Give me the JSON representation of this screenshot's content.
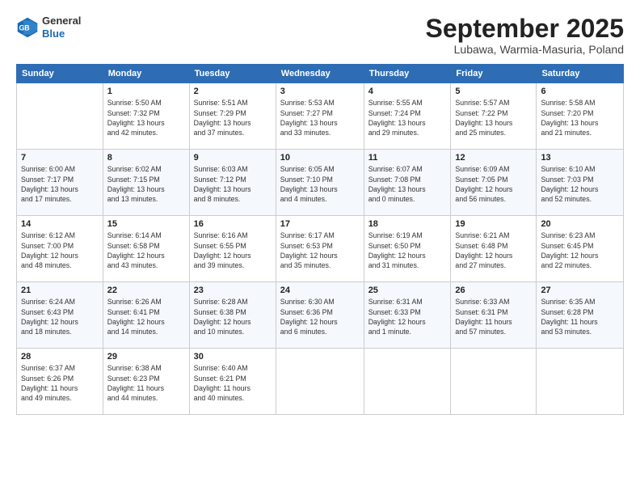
{
  "header": {
    "logo": {
      "line1": "General",
      "line2": "Blue"
    },
    "title": "September 2025",
    "location": "Lubawa, Warmia-Masuria, Poland"
  },
  "days_of_week": [
    "Sunday",
    "Monday",
    "Tuesday",
    "Wednesday",
    "Thursday",
    "Friday",
    "Saturday"
  ],
  "weeks": [
    [
      {
        "day": "",
        "info": ""
      },
      {
        "day": "1",
        "info": "Sunrise: 5:50 AM\nSunset: 7:32 PM\nDaylight: 13 hours\nand 42 minutes."
      },
      {
        "day": "2",
        "info": "Sunrise: 5:51 AM\nSunset: 7:29 PM\nDaylight: 13 hours\nand 37 minutes."
      },
      {
        "day": "3",
        "info": "Sunrise: 5:53 AM\nSunset: 7:27 PM\nDaylight: 13 hours\nand 33 minutes."
      },
      {
        "day": "4",
        "info": "Sunrise: 5:55 AM\nSunset: 7:24 PM\nDaylight: 13 hours\nand 29 minutes."
      },
      {
        "day": "5",
        "info": "Sunrise: 5:57 AM\nSunset: 7:22 PM\nDaylight: 13 hours\nand 25 minutes."
      },
      {
        "day": "6",
        "info": "Sunrise: 5:58 AM\nSunset: 7:20 PM\nDaylight: 13 hours\nand 21 minutes."
      }
    ],
    [
      {
        "day": "7",
        "info": "Sunrise: 6:00 AM\nSunset: 7:17 PM\nDaylight: 13 hours\nand 17 minutes."
      },
      {
        "day": "8",
        "info": "Sunrise: 6:02 AM\nSunset: 7:15 PM\nDaylight: 13 hours\nand 13 minutes."
      },
      {
        "day": "9",
        "info": "Sunrise: 6:03 AM\nSunset: 7:12 PM\nDaylight: 13 hours\nand 8 minutes."
      },
      {
        "day": "10",
        "info": "Sunrise: 6:05 AM\nSunset: 7:10 PM\nDaylight: 13 hours\nand 4 minutes."
      },
      {
        "day": "11",
        "info": "Sunrise: 6:07 AM\nSunset: 7:08 PM\nDaylight: 13 hours\nand 0 minutes."
      },
      {
        "day": "12",
        "info": "Sunrise: 6:09 AM\nSunset: 7:05 PM\nDaylight: 12 hours\nand 56 minutes."
      },
      {
        "day": "13",
        "info": "Sunrise: 6:10 AM\nSunset: 7:03 PM\nDaylight: 12 hours\nand 52 minutes."
      }
    ],
    [
      {
        "day": "14",
        "info": "Sunrise: 6:12 AM\nSunset: 7:00 PM\nDaylight: 12 hours\nand 48 minutes."
      },
      {
        "day": "15",
        "info": "Sunrise: 6:14 AM\nSunset: 6:58 PM\nDaylight: 12 hours\nand 43 minutes."
      },
      {
        "day": "16",
        "info": "Sunrise: 6:16 AM\nSunset: 6:55 PM\nDaylight: 12 hours\nand 39 minutes."
      },
      {
        "day": "17",
        "info": "Sunrise: 6:17 AM\nSunset: 6:53 PM\nDaylight: 12 hours\nand 35 minutes."
      },
      {
        "day": "18",
        "info": "Sunrise: 6:19 AM\nSunset: 6:50 PM\nDaylight: 12 hours\nand 31 minutes."
      },
      {
        "day": "19",
        "info": "Sunrise: 6:21 AM\nSunset: 6:48 PM\nDaylight: 12 hours\nand 27 minutes."
      },
      {
        "day": "20",
        "info": "Sunrise: 6:23 AM\nSunset: 6:45 PM\nDaylight: 12 hours\nand 22 minutes."
      }
    ],
    [
      {
        "day": "21",
        "info": "Sunrise: 6:24 AM\nSunset: 6:43 PM\nDaylight: 12 hours\nand 18 minutes."
      },
      {
        "day": "22",
        "info": "Sunrise: 6:26 AM\nSunset: 6:41 PM\nDaylight: 12 hours\nand 14 minutes."
      },
      {
        "day": "23",
        "info": "Sunrise: 6:28 AM\nSunset: 6:38 PM\nDaylight: 12 hours\nand 10 minutes."
      },
      {
        "day": "24",
        "info": "Sunrise: 6:30 AM\nSunset: 6:36 PM\nDaylight: 12 hours\nand 6 minutes."
      },
      {
        "day": "25",
        "info": "Sunrise: 6:31 AM\nSunset: 6:33 PM\nDaylight: 12 hours\nand 1 minute."
      },
      {
        "day": "26",
        "info": "Sunrise: 6:33 AM\nSunset: 6:31 PM\nDaylight: 11 hours\nand 57 minutes."
      },
      {
        "day": "27",
        "info": "Sunrise: 6:35 AM\nSunset: 6:28 PM\nDaylight: 11 hours\nand 53 minutes."
      }
    ],
    [
      {
        "day": "28",
        "info": "Sunrise: 6:37 AM\nSunset: 6:26 PM\nDaylight: 11 hours\nand 49 minutes."
      },
      {
        "day": "29",
        "info": "Sunrise: 6:38 AM\nSunset: 6:23 PM\nDaylight: 11 hours\nand 44 minutes."
      },
      {
        "day": "30",
        "info": "Sunrise: 6:40 AM\nSunset: 6:21 PM\nDaylight: 11 hours\nand 40 minutes."
      },
      {
        "day": "",
        "info": ""
      },
      {
        "day": "",
        "info": ""
      },
      {
        "day": "",
        "info": ""
      },
      {
        "day": "",
        "info": ""
      }
    ]
  ]
}
